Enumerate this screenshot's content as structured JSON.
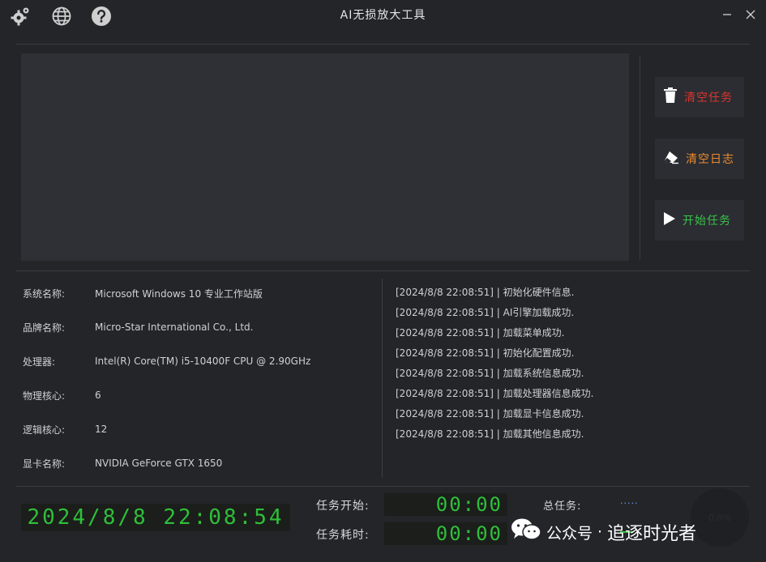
{
  "window": {
    "title": "AI无损放大工具"
  },
  "toolbar": {
    "icons": [
      "settings-icon",
      "globe-icon",
      "help-icon"
    ]
  },
  "actions": {
    "clear_tasks": {
      "label": "清空任务",
      "color": "#e0342b",
      "icon": "trash-icon"
    },
    "clear_log": {
      "label": "清空日志",
      "color": "#ee8a2e",
      "icon": "eraser-icon"
    },
    "start_task": {
      "label": "开始任务",
      "color": "#39c24a",
      "icon": "play-icon"
    }
  },
  "system_info": [
    {
      "label": "系统名称:",
      "value": "Microsoft Windows 10 专业工作站版"
    },
    {
      "label": "品牌名称:",
      "value": "Micro-Star International Co., Ltd."
    },
    {
      "label": "处理器:",
      "value": "Intel(R) Core(TM) i5-10400F CPU @ 2.90GHz"
    },
    {
      "label": "物理核心:",
      "value": "6"
    },
    {
      "label": "逻辑核心:",
      "value": "12"
    },
    {
      "label": "显卡名称:",
      "value": "NVIDIA GeForce GTX 1650"
    }
  ],
  "log": [
    "[2024/8/8 22:08:51] | 初始化硬件信息.",
    "[2024/8/8 22:08:51] | AI引擎加载成功.",
    "[2024/8/8 22:08:51] | 加载菜单成功.",
    "[2024/8/8 22:08:51] | 初始化配置成功.",
    "[2024/8/8 22:08:51] | 加载系统信息成功.",
    "[2024/8/8 22:08:51] | 加载处理器信息成功.",
    "[2024/8/8 22:08:51] | 加载显卡信息成功.",
    "[2024/8/8 22:08:51] | 加载其他信息成功."
  ],
  "status": {
    "clock": "2024/8/8 22:08:54",
    "task_start_label": "任务开始:",
    "task_start_value": "00:00",
    "task_elapsed_label": "任务耗时:",
    "task_elapsed_value": "00:00",
    "total_tasks_label": "总任务:",
    "total_tasks_value": ".....",
    "progress_text": "0.0%"
  },
  "watermark": {
    "prefix": "公众号",
    "separator": "·",
    "name": "追逐时光者"
  },
  "colors": {
    "background": "#232529",
    "panel": "#2e3035",
    "led_green": "#2fbf3a"
  }
}
